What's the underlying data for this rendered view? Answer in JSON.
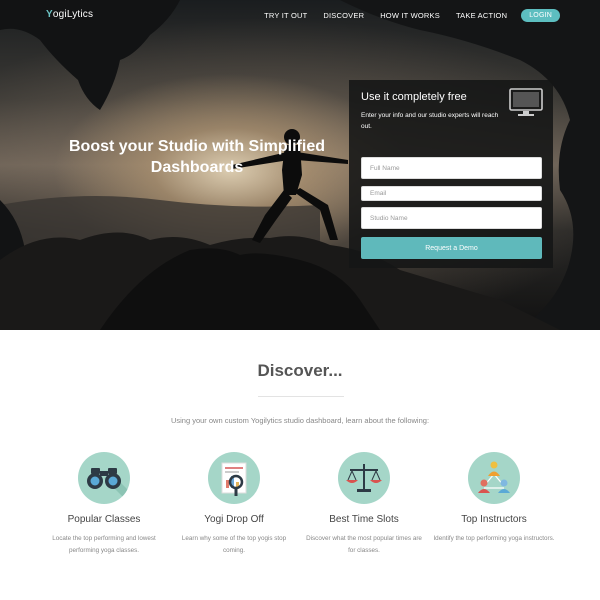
{
  "header": {
    "logo_y": "Y",
    "logo_rest": "ogiLytics",
    "nav": [
      "TRY IT OUT",
      "DISCOVER",
      "HOW IT WORKS",
      "TAKE ACTION"
    ],
    "login_label": "LOGIN"
  },
  "hero": {
    "title": "Boost your Studio with Simplified Dashboards"
  },
  "signup": {
    "title": "Use it completely free",
    "description": "Enter your info and our studio experts will reach out.",
    "fields": [
      {
        "placeholder": "Full Name"
      },
      {
        "placeholder": "Email"
      },
      {
        "placeholder": "Studio Name"
      }
    ],
    "button_label": "Request a Demo",
    "icon": "monitor-icon"
  },
  "discover": {
    "title": "Discover...",
    "subtitle": "Using your own custom Yogilytics studio dashboard, learn about the following:",
    "features": [
      {
        "title": "Popular Classes",
        "description": "Locate the top performing and lowest performing yoga classes.",
        "icon": "binoculars-icon"
      },
      {
        "title": "Yogi Drop Off",
        "description": "Learn why some of the top yogis stop coming.",
        "icon": "magnifier-chart-icon"
      },
      {
        "title": "Best Time Slots",
        "description": "Discover what the most popular times are for classes.",
        "icon": "scale-icon"
      },
      {
        "title": "Top Instructors",
        "description": "Identify the top performing yoga instructors.",
        "icon": "people-network-icon"
      }
    ]
  },
  "colors": {
    "accent": "#5dbec0",
    "icon_circle": "#a5d6c8"
  }
}
